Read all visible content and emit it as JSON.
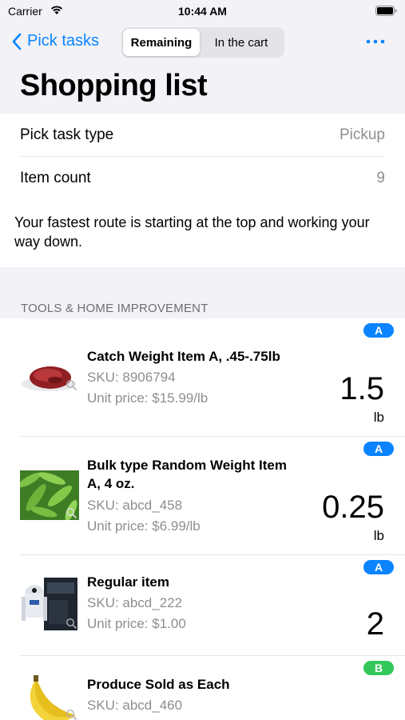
{
  "status": {
    "carrier": "Carrier",
    "time": "10:44 AM"
  },
  "nav": {
    "back_label": "Pick tasks",
    "segments": [
      "Remaining",
      "In the cart"
    ],
    "selected_segment": "Remaining",
    "more_icon": "ellipsis-icon"
  },
  "title": "Shopping list",
  "info": {
    "rows": [
      {
        "label": "Pick task type",
        "value": "Pickup"
      },
      {
        "label": "Item count",
        "value": "9"
      }
    ],
    "note": "Your fastest route is starting at the top and working your way down."
  },
  "section": {
    "header": "TOOLS & HOME IMPROVEMENT"
  },
  "items": [
    {
      "badge": "A",
      "name": "Catch Weight Item A, .45-.75lb",
      "sku": "SKU: 8906794",
      "price": "Unit price: $15.99/lb",
      "quantity": "1.5",
      "unit": "lb",
      "image": "raw-meat"
    },
    {
      "badge": "A",
      "name": "Bulk type Random Weight Item A, 4 oz.",
      "sku": "SKU: abcd_458",
      "price": "Unit price: $6.99/lb",
      "quantity": "0.25",
      "unit": "lb",
      "image": "green-peas"
    },
    {
      "badge": "A",
      "name": "Regular item",
      "sku": "SKU: abcd_222",
      "price": "Unit price: $1.00",
      "quantity": "2",
      "unit": "",
      "image": "robot-toy-box"
    },
    {
      "badge": "B",
      "name": "Produce Sold as Each",
      "sku": "SKU: abcd_460",
      "price": "",
      "quantity": "",
      "unit": "",
      "image": "bananas"
    }
  ],
  "colors": {
    "accent": "#0a84ff",
    "badge_a": "#0a84ff",
    "badge_b": "#34c759",
    "background": "#f2f2f7"
  }
}
